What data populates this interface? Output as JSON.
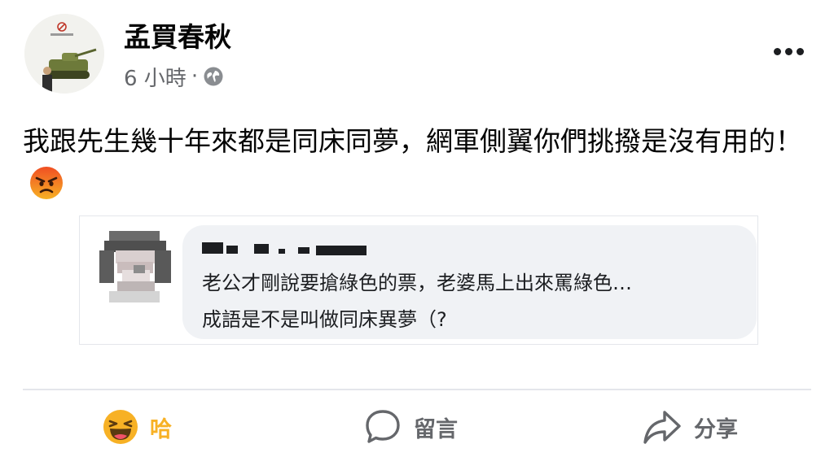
{
  "post": {
    "author_name": "孟買春秋",
    "timestamp": "6 小時",
    "separator": "·",
    "privacy_icon": "globe-icon",
    "more_icon": "more-options-icon",
    "text": "我跟先生幾十年來都是同床同夢，網軍側翼你們挑撥是沒有用的！",
    "emoji": "angry-face-emoji"
  },
  "embedded_comment": {
    "line1": "老公才剛說要搶綠色的票，老婆馬上出來罵綠色…",
    "line2": "成語是不是叫做同床異夢（?"
  },
  "actions": {
    "haha_label": "哈",
    "haha_icon": "haha-emoji-icon",
    "comment_label": "留言",
    "comment_icon": "speech-bubble-icon",
    "share_label": "分享",
    "share_icon": "share-arrow-icon"
  },
  "colors": {
    "text": "#050505",
    "secondary_text": "#65676b",
    "haha_active": "#f7b125",
    "bubble_bg": "#f0f2f5",
    "divider": "#e4e6eb",
    "angry_top": "#f04e23",
    "angry_bottom": "#f7b125"
  }
}
